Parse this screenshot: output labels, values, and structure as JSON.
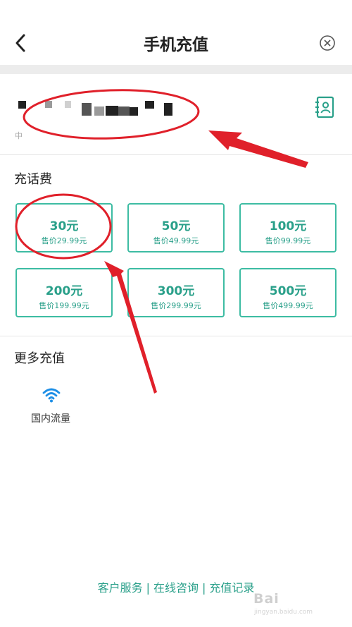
{
  "header": {
    "title": "手机充值",
    "back_icon": "chevron-left-icon",
    "close_icon": "close-circle-icon"
  },
  "phone": {
    "number_masked": true,
    "carrier_label": "中",
    "contacts_icon": "contact-book-icon"
  },
  "recharge": {
    "section_title": "充话费",
    "options": [
      {
        "amount": "30元",
        "price": "售价29.99元"
      },
      {
        "amount": "50元",
        "price": "售价49.99元"
      },
      {
        "amount": "100元",
        "price": "售价99.99元"
      },
      {
        "amount": "200元",
        "price": "售价199.99元"
      },
      {
        "amount": "300元",
        "price": "售价299.99元"
      },
      {
        "amount": "500元",
        "price": "售价499.99元"
      }
    ]
  },
  "more": {
    "section_title": "更多充值",
    "items": [
      {
        "label": "国内流量",
        "icon": "wifi-icon"
      }
    ]
  },
  "footer": {
    "service": "客户服务",
    "consult": "在线咨询",
    "records": "充值记录",
    "separator": "|"
  },
  "watermark": {
    "brand": "Bai",
    "sub": "jingyan.baidu.com"
  },
  "colors": {
    "accent": "#2aa08a",
    "border": "#3dbca3",
    "annotation": "#e0202a",
    "wifi": "#1e8fe6"
  }
}
